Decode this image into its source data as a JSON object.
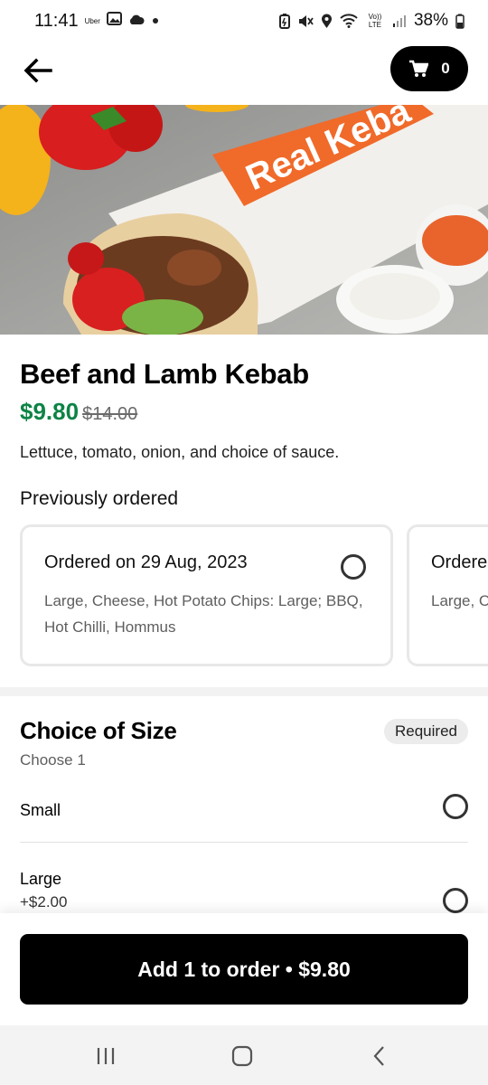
{
  "status_bar": {
    "time": "11:41",
    "app_label": "Uber",
    "network_label": "Vo)) LTE",
    "battery": "38%"
  },
  "header": {
    "back_icon": "arrow-left-icon",
    "cart_icon": "cart-icon",
    "cart_count": "0"
  },
  "hero": {
    "bag_text": "Real Keba"
  },
  "item": {
    "title": "Beef and Lamb Kebab",
    "price": "$9.80",
    "original_price": "$14.00",
    "description": "Lettuce, tomato, onion, and choice of sauce."
  },
  "previously_ordered": {
    "title": "Previously ordered",
    "orders": [
      {
        "title": "Ordered on 29 Aug, 2023",
        "details": "Large, Cheese, Hot Potato Chips: Large; BBQ, Hot Chilli, Hommus"
      },
      {
        "title": "Ordere",
        "details": "Large, C"
      }
    ]
  },
  "size_section": {
    "title": "Choice of Size",
    "badge": "Required",
    "note": "Choose 1",
    "options": [
      {
        "label": "Small",
        "extra": ""
      },
      {
        "label": "Large",
        "extra": "+$2.00"
      }
    ]
  },
  "cta": {
    "label": "Add 1 to order • $9.80"
  },
  "nav": {
    "recent_icon": "recent-apps-icon",
    "home_icon": "home-icon",
    "back_icon": "nav-back-icon"
  },
  "colors": {
    "price_green": "#0e8345",
    "bag_orange": "#f06a2a",
    "primary": "#000000"
  }
}
